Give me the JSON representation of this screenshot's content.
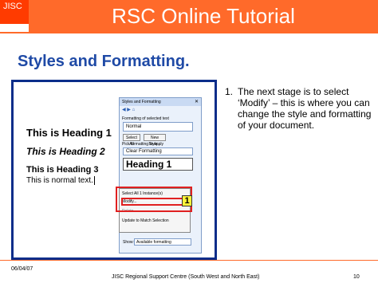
{
  "header": {
    "logo": "JISC",
    "title": "RSC Online Tutorial"
  },
  "slide": {
    "heading": "Styles and Formatting."
  },
  "document": {
    "heading1": "This is Heading 1",
    "heading2": "This is Heading 2",
    "heading3": "This is Heading 3",
    "normal": "This is normal text."
  },
  "task_pane": {
    "title": "Styles and Formatting",
    "selected_label": "Formatting of selected text",
    "selected_value": "Normal",
    "select_all_button": "Select All",
    "new_style_button": "New Style...",
    "pick_label": "Pick formatting to apply",
    "clear_formatting": "Clear Formatting",
    "heading_sample": "Heading 1",
    "show_label": "Show:",
    "show_value": "Available formatting"
  },
  "context_menu": {
    "items": [
      "Select All 1 Instance(s)",
      "Modify...",
      "Delete...",
      "Update to Match Selection"
    ],
    "callout": "1"
  },
  "instructions": {
    "number": "1.",
    "text": "The next stage is to select ‘Modify’ – this is where you can change the style and formatting of your document."
  },
  "footer": {
    "date": "06/04/07",
    "organization": "JISC Regional Support Centre (South West and North East)",
    "page": "10"
  },
  "colors": {
    "brand_orange": "#ff6a2a",
    "logo_orange": "#ff3b00",
    "heading_blue": "#1f4aa6",
    "frame_blue": "#0b2d8a",
    "highlight_red": "#e02020"
  }
}
